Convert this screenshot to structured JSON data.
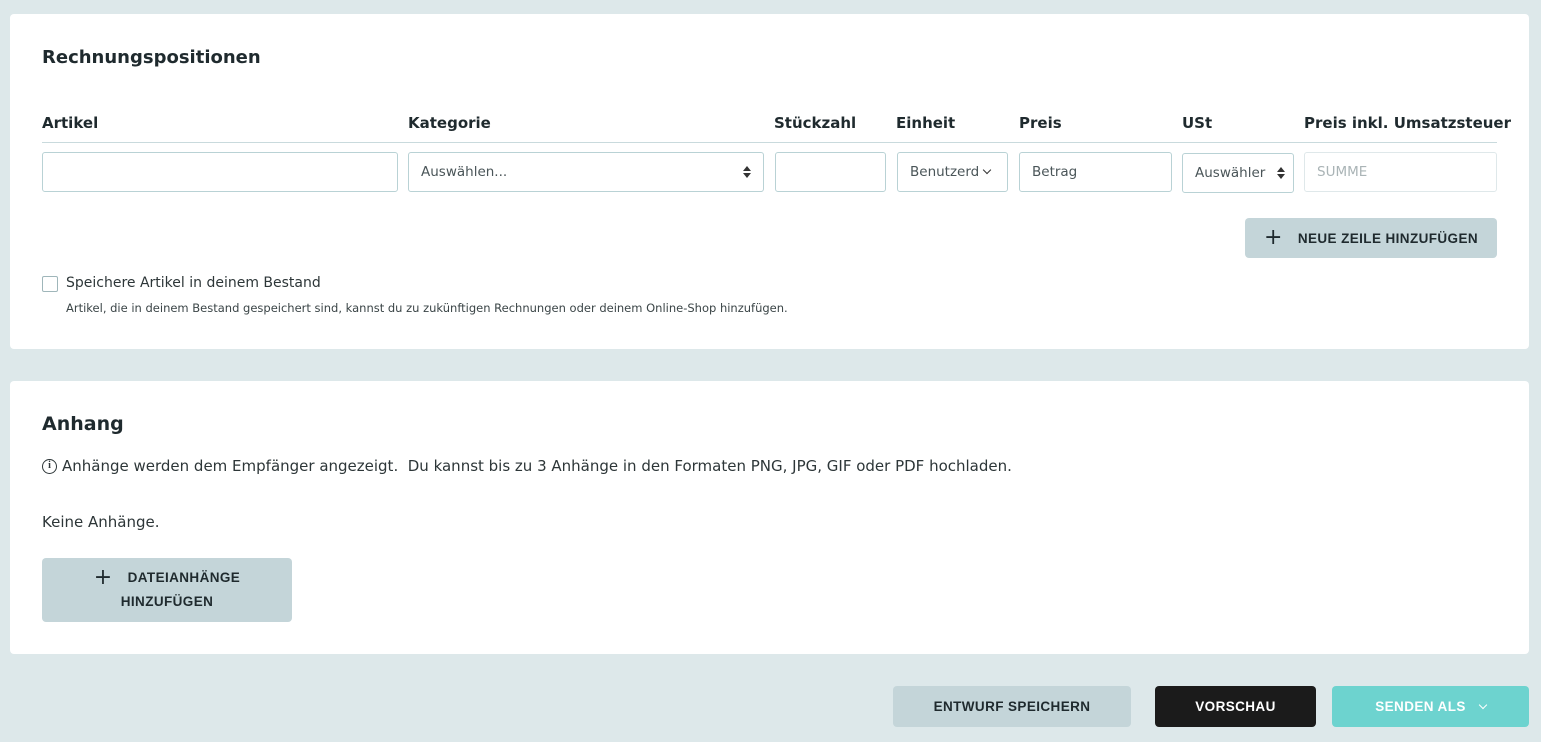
{
  "items_section": {
    "title": "Rechnungspositionen",
    "columns": {
      "artikel": "Artikel",
      "kategorie": "Kategorie",
      "stueckzahl": "Stückzahl",
      "einheit": "Einheit",
      "preis": "Preis",
      "ust": "USt",
      "preis_inkl": "Preis inkl. Umsatzsteuer"
    },
    "row": {
      "artikel_value": "",
      "kategorie_value": "Auswählen...",
      "stueckzahl_value": "",
      "einheit_value": "Benutzerd",
      "preis_placeholder": "Betrag",
      "ust_value": "Auswähler",
      "summe_placeholder": "SUMME"
    },
    "add_row_label": "NEUE ZEILE HINZUFÜGEN",
    "save_checkbox_label": "Speichere Artikel in deinem Bestand",
    "save_checkbox_checked": false,
    "save_hint": "Artikel, die in deinem Bestand gespeichert sind, kannst du zu zukünftigen Rechnungen oder deinem Online-Shop hinzufügen."
  },
  "attachments_section": {
    "title": "Anhang",
    "info_text": "Anhänge werden dem Empfänger angezeigt.  Du kannst bis zu 3 Anhänge in den Formaten PNG, JPG, GIF oder PDF hochladen.",
    "empty_text": "Keine Anhänge.",
    "add_button_line1": "DATEIANHÄNGE",
    "add_button_line2": "HINZUFÜGEN"
  },
  "footer": {
    "draft_label": "ENTWURF SPEICHERN",
    "preview_label": "VORSCHAU",
    "send_label": "SENDEN ALS"
  },
  "colors": {
    "page_background": "#dde8ea",
    "secondary_button": "#c4d5d9",
    "primary_dark": "#1b1b1b",
    "accent_teal": "#6dd3cf"
  }
}
